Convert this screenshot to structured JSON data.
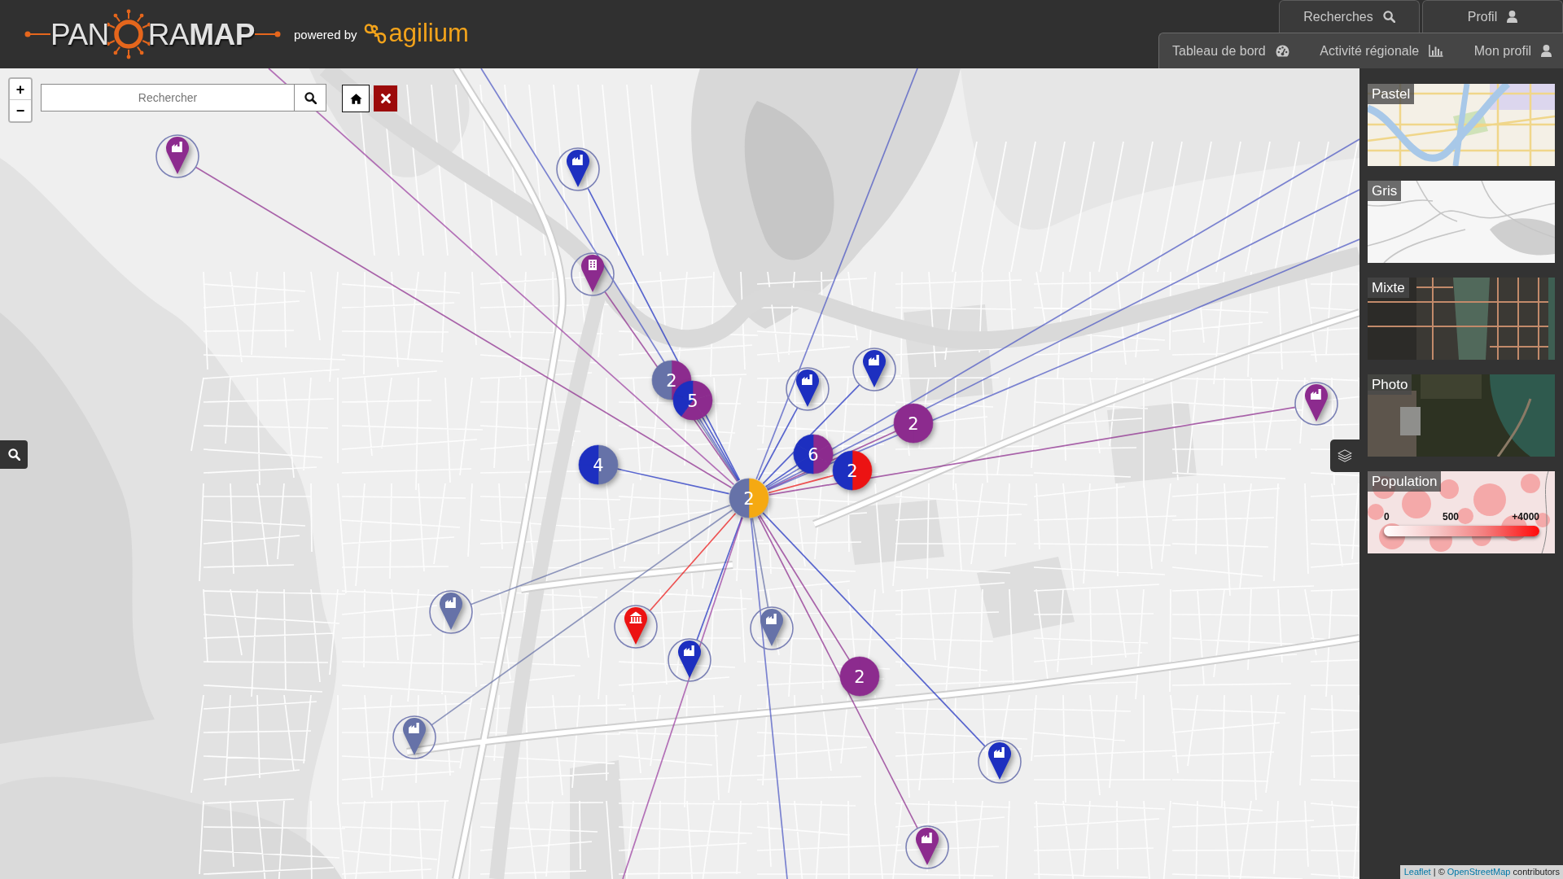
{
  "header": {
    "logo": {
      "start": "PAN",
      "end": "RA**MAP**"
    },
    "powered_by": "powered by",
    "partner": "agilium"
  },
  "top_tabs": [
    {
      "label": "Recherches",
      "kind": "search"
    },
    {
      "label": "Profil",
      "kind": "user"
    }
  ],
  "nav_links": [
    {
      "label": "Tableau de bord",
      "kind": "gauge"
    },
    {
      "label": "Activité régionale",
      "kind": "chart"
    },
    {
      "label": "Mon profil",
      "kind": "user"
    }
  ],
  "map": {
    "zoom": {
      "zoom_in": "+",
      "zoom_out": "−"
    },
    "search": {
      "placeholder": "Rechercher"
    },
    "pins": [
      {
        "kind": "factory",
        "color": "#8c2b8e"
      },
      {
        "kind": "factory",
        "color": "#1d2fc0"
      },
      {
        "kind": "office",
        "color": "#8c2b8e"
      },
      {
        "kind": "factory",
        "color": "#1d2fc0"
      },
      {
        "kind": "factory",
        "color": "#1d2fc0"
      },
      {
        "kind": "factory",
        "color": "#8c2b8e"
      },
      {
        "kind": "factory",
        "color": "#6672a8"
      },
      {
        "kind": "institution",
        "color": "#ec1313"
      },
      {
        "kind": "factory",
        "color": "#6672a8"
      },
      {
        "kind": "factory",
        "color": "#1d2fc0"
      },
      {
        "kind": "factory",
        "color": "#6672a8"
      },
      {
        "kind": "factory",
        "color": "#1d2fc0"
      },
      {
        "kind": "factory",
        "color": "#8c2b8e"
      }
    ],
    "clusters": [
      {
        "count": "2",
        "slices": [
          {
            "color": "#8c2b8e"
          },
          {
            "color": "#6672a8"
          }
        ]
      },
      {
        "count": "5",
        "slices": [
          {
            "color": "#8c2b8e"
          },
          {
            "color": "#8c2b8e"
          },
          {
            "color": "#8c2b8e"
          },
          {
            "color": "#1d2fc0"
          },
          {
            "color": "#1d2fc0"
          }
        ]
      },
      {
        "count": "2",
        "slices": [
          {
            "color": "#8c2b8e"
          },
          {
            "color": "#8c2b8e"
          }
        ]
      },
      {
        "count": "6",
        "slices": [
          {
            "color": "#8c2b8e"
          },
          {
            "color": "#8c2b8e"
          },
          {
            "color": "#8c2b8e"
          },
          {
            "color": "#1d2fc0"
          },
          {
            "color": "#1d2fc0"
          },
          {
            "color": "#1d2fc0"
          }
        ]
      },
      {
        "count": "4",
        "slices": [
          {
            "color": "#6672a8"
          },
          {
            "color": "#6672a8"
          },
          {
            "color": "#1d2fc0"
          },
          {
            "color": "#1d2fc0"
          }
        ]
      },
      {
        "count": "2",
        "slices": [
          {
            "color": "#ec1313"
          },
          {
            "color": "#1d2fc0"
          }
        ]
      },
      {
        "count": "2",
        "slices": [
          {
            "color": "#f5a912"
          },
          {
            "color": "#6672a8"
          }
        ]
      },
      {
        "count": "2",
        "slices": [
          {
            "color": "#8c2b8e"
          },
          {
            "color": "#8c2b8e"
          }
        ]
      }
    ]
  },
  "layers": [
    {
      "label": "Pastel",
      "kind": "pastel"
    },
    {
      "label": "Gris",
      "kind": "grey"
    },
    {
      "label": "Mixte",
      "kind": "hybrid"
    },
    {
      "label": "Photo",
      "kind": "satellite"
    },
    {
      "label": "Population",
      "kind": "population",
      "legend": [
        "0",
        "500",
        "+4000"
      ]
    }
  ],
  "attribution": {
    "links": [
      "Leaflet",
      "OpenStreetMap"
    ],
    "separator": "| ©",
    "suffix": "contributors"
  }
}
